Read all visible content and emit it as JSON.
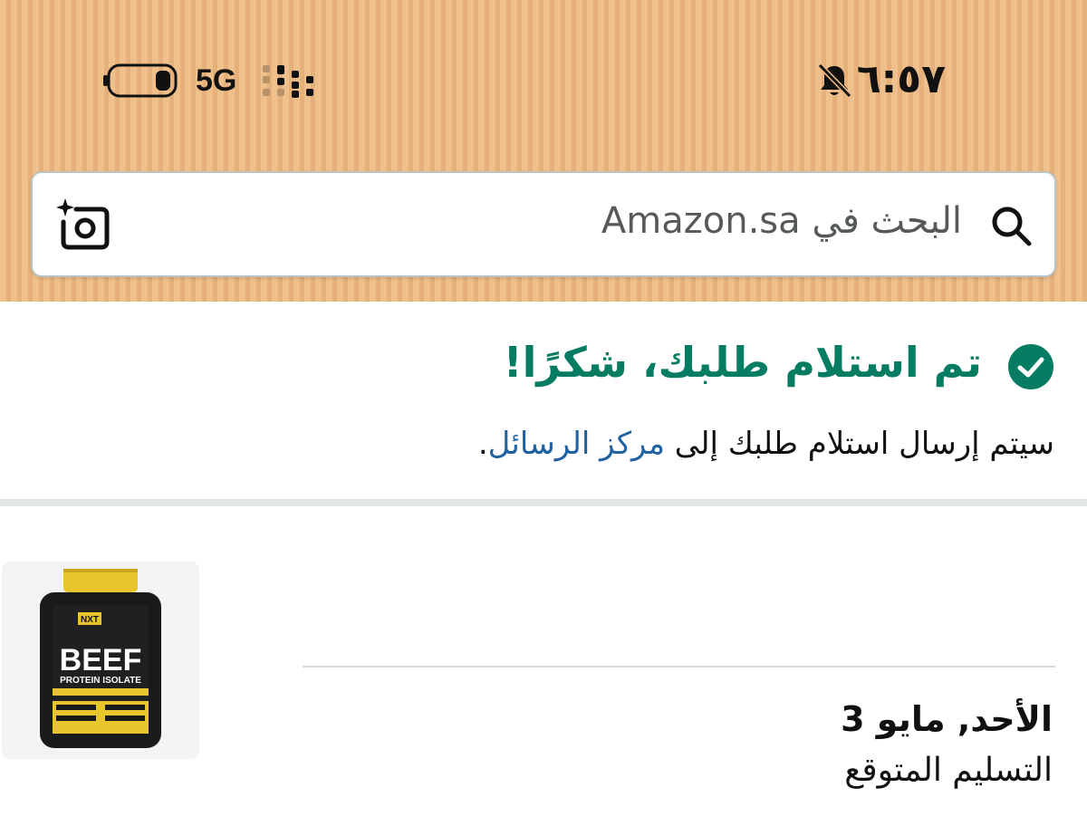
{
  "status_bar": {
    "time": "٦:٥٧",
    "network": "5G"
  },
  "search": {
    "placeholder": "البحث في Amazon.sa"
  },
  "confirmation": {
    "title": "تم استلام طلبك، شكرًا!",
    "message_prefix": "سيتم إرسال استلام طلبك إلى ",
    "message_link": "مركز الرسائل",
    "message_suffix": ".",
    "accent_color": "#067d62",
    "link_color": "#2162a1"
  },
  "product": {
    "image_text": {
      "brand": "NXT",
      "name_line1": "BEEF",
      "name_line2": "PROTEIN ISOLATE"
    }
  },
  "delivery": {
    "date": "الأحد, مايو 3",
    "label": "التسليم المتوقع"
  }
}
